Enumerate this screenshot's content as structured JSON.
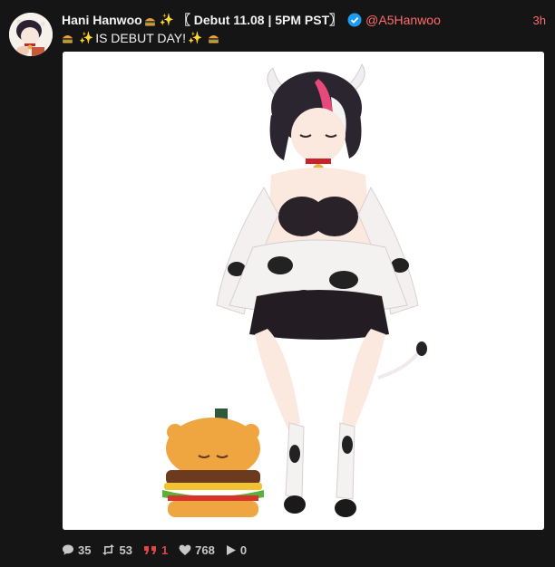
{
  "tweet": {
    "display_name": "Hani Hanwoo",
    "name_suffix": "〖 Debut 11.08 | 5PM PST〗",
    "handle": "@A5Hanwoo",
    "time": "3h",
    "text": "IS DEBUT DAY!",
    "verified": true,
    "accent_color": "#ff6b6b",
    "verified_color": "#1d9bf0"
  },
  "media": {
    "alt_icon": "cow-girl-character-with-burger-mascot",
    "background": "#ffffff"
  },
  "actions": {
    "replies": "35",
    "retweets": "53",
    "quotes": "1",
    "likes": "768",
    "views": "0"
  }
}
